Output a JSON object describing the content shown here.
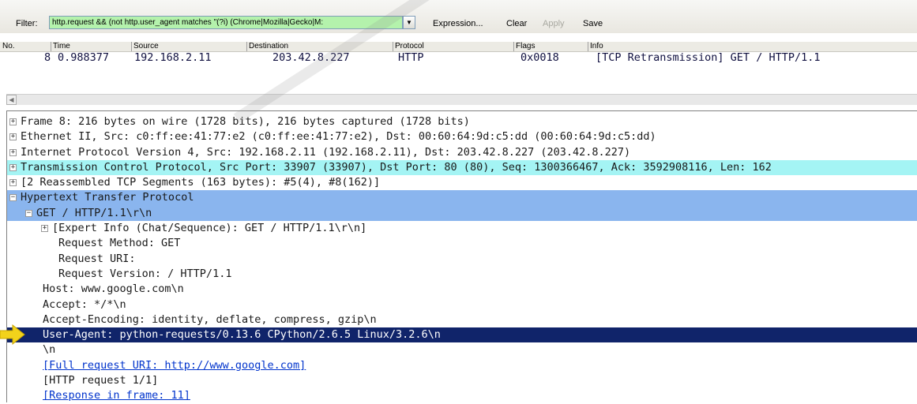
{
  "filter": {
    "label": "Filter:",
    "value": "http.request && (not http.user_agent matches \"(?i) (Chrome|Mozilla|Gecko|M:",
    "dropdown_icon": "▼",
    "expression_label": "Expression...",
    "clear_label": "Clear",
    "apply_label": "Apply",
    "save_label": "Save"
  },
  "packet_list": {
    "columns": [
      "No.",
      "Time",
      "Source",
      "Destination",
      "Protocol",
      "Flags",
      "Info"
    ],
    "rows": [
      {
        "no": "8",
        "time": "0.988377",
        "source": "192.168.2.11",
        "destination": "203.42.8.227",
        "protocol": "HTTP",
        "flags": "0x0018",
        "info": "[TCP Retransmission] GET  / HTTP/1.1"
      }
    ]
  },
  "scrollbar": {
    "left_arrow": "◀"
  },
  "details": {
    "rows": [
      {
        "text": "Frame 8: 216 bytes on wire (1728 bits), 216 bytes captured (1728 bits)",
        "toggle": "+"
      },
      {
        "text": "Ethernet II, Src: c0:ff:ee:41:77:e2 (c0:ff:ee:41:77:e2), Dst: 00:60:64:9d:c5:dd (00:60:64:9d:c5:dd)",
        "toggle": "+"
      },
      {
        "text": "Internet Protocol Version 4, Src: 192.168.2.11 (192.168.2.11), Dst: 203.42.8.227 (203.42.8.227)",
        "toggle": "+"
      },
      {
        "text": "Transmission Control Protocol, Src Port: 33907 (33907), Dst Port: 80 (80), Seq: 1300366467, Ack: 3592908116, Len: 162",
        "toggle": "+"
      },
      {
        "text": "[2 Reassembled TCP Segments (163 bytes): #5(4), #8(162)]",
        "toggle": "+"
      },
      {
        "text": "Hypertext Transfer Protocol",
        "toggle": "−"
      },
      {
        "text": "GET  / HTTP/1.1\\r\\n",
        "toggle": "−"
      },
      {
        "text": "[Expert Info (Chat/Sequence): GET  / HTTP/1.1\\r\\n]",
        "toggle": "+"
      },
      {
        "text": "Request Method: GET",
        "toggle": ""
      },
      {
        "text": "Request URI: ",
        "toggle": ""
      },
      {
        "text": "Request Version: / HTTP/1.1",
        "toggle": ""
      },
      {
        "text": "Host: www.google.com\\n",
        "toggle": ""
      },
      {
        "text": "Accept: */*\\n",
        "toggle": ""
      },
      {
        "text": "Accept-Encoding: identity, deflate, compress, gzip\\n",
        "toggle": ""
      },
      {
        "text": "User-Agent: python-requests/0.13.6 CPython/2.6.5 Linux/3.2.6\\n",
        "toggle": ""
      },
      {
        "text": "\\n",
        "toggle": ""
      },
      {
        "text": "[Full request URI: http://www.google.com]",
        "toggle": ""
      },
      {
        "text": "[HTTP request 1/1]",
        "toggle": ""
      },
      {
        "text": "[Response in frame: 11]",
        "toggle": ""
      }
    ]
  },
  "colors": {
    "filter_valid_bg": "#b4f2ac",
    "tcp_row_bg": "#a4f4f4",
    "http_row_bg": "#8ab5ee",
    "selected_row_bg": "#10246a",
    "link_color": "#0033cc",
    "arrow_color": "#f2d21b"
  },
  "icons": {
    "arrow": "arrow-pointer-icon",
    "expand": "expand-plus-icon",
    "collapse": "collapse-minus-icon"
  }
}
